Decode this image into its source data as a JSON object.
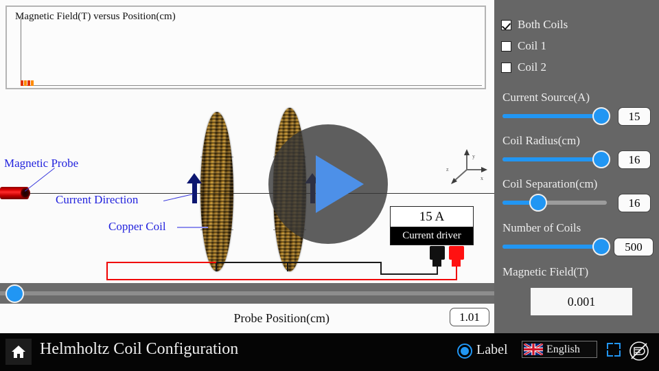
{
  "graph": {
    "title": "Magnetic Field(T) versus Position(cm)",
    "ylabel": "Magnetic Field(T)",
    "xlabel": "Position(cm)"
  },
  "chart_data": {
    "type": "scatter",
    "title": "Magnetic Field(T) versus Position(cm)",
    "xlabel": "Position(cm)",
    "ylabel": "Magnetic Field(T)",
    "grid": false,
    "legend": "none",
    "x": [
      1.01,
      1.01,
      1.01
    ],
    "y": [
      0.001,
      0.001,
      0.001
    ],
    "series": [
      {
        "name": "Magnetic Field",
        "color": "#ff3300",
        "values": [
          0.001,
          0.001,
          0.001
        ]
      }
    ],
    "xlim": [
      0,
      40
    ],
    "ylim": [
      0,
      0.02
    ]
  },
  "scene": {
    "probe_label": "Magnetic Probe",
    "current_direction_label": "Current Direction",
    "copper_coil_label": "Copper Coil",
    "driver_reading": "15 A",
    "driver_name": "Current driver",
    "axis_x": "x",
    "axis_y": "y",
    "axis_z": "z",
    "play_icon": "play-icon"
  },
  "probe_position": {
    "label": "Probe Position(cm)",
    "value": "1.01",
    "slider_percent": 1
  },
  "sidebar": {
    "checkboxes": [
      {
        "label": "Both Coils",
        "checked": true
      },
      {
        "label": "Coil 1",
        "checked": false
      },
      {
        "label": "Coil 2",
        "checked": false
      }
    ],
    "sliders": [
      {
        "label": "Current Source(A)",
        "value": "15",
        "percent": 95
      },
      {
        "label": "Coil Radius(cm)",
        "value": "16",
        "percent": 95
      },
      {
        "label": "Coil Separation(cm)",
        "value": "16",
        "percent": 33
      },
      {
        "label": "Number of Coils",
        "value": "500",
        "percent": 95
      }
    ],
    "readout": {
      "label": "Magnetic Field(T)",
      "value": "0.001"
    }
  },
  "bottombar": {
    "home_icon": "home-icon",
    "title": "Helmholtz Coil Configuration",
    "label_toggle": "Label",
    "label_toggle_on": true,
    "language": "English",
    "language_flag": "uk-flag-icon",
    "fullscreen_icon": "fullscreen-icon",
    "no_screenshot_icon": "no-screenshot-icon"
  },
  "colors": {
    "accent": "#2196f3",
    "sidebar_bg": "#666666",
    "bottombar_bg": "#050505",
    "label_blue": "#2222dd",
    "wire_red": "#f00000",
    "copper": "#c99326"
  }
}
